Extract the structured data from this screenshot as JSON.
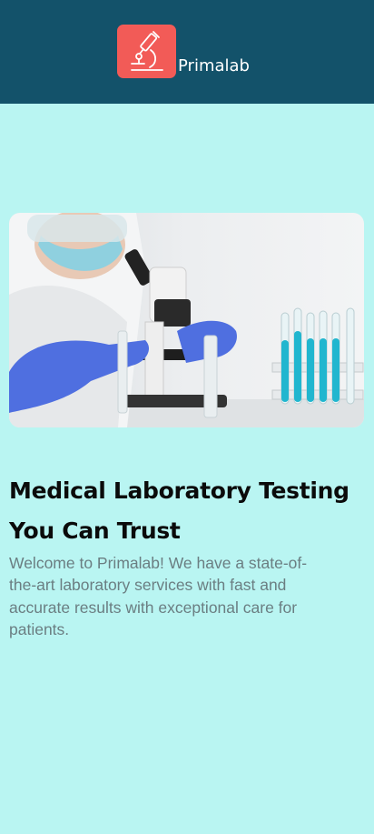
{
  "header": {
    "brand_name": "Primalab",
    "logo_icon": "microscope-icon",
    "background_color": "#13526a",
    "logo_color": "#f25b57"
  },
  "hero": {
    "image": "laboratory-scientist-microscope-photo"
  },
  "main": {
    "title": "Medical Laboratory Testing You Can Trust",
    "description": "Welcome to Primalab! We have a state-of-the-art laboratory services with fast and accurate results with exceptional care for patients."
  },
  "colors": {
    "page_background": "#b9f5f2",
    "title_text": "#0b0b0b",
    "body_text": "#6b7e82"
  }
}
